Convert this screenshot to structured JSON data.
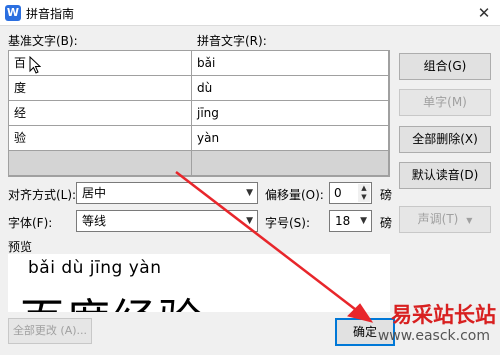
{
  "window": {
    "title": "拼音指南",
    "app_icon_glyph": "W",
    "close_glyph": "✕"
  },
  "columns": {
    "base_text": "基准文字(B):",
    "pinyin_text": "拼音文字(R):"
  },
  "rows": [
    {
      "base": "百",
      "pinyin": "bǎi"
    },
    {
      "base": "度",
      "pinyin": "dù"
    },
    {
      "base": "经",
      "pinyin": "jīng"
    },
    {
      "base": "验",
      "pinyin": "yàn"
    }
  ],
  "buttons": {
    "combine": "组合(G)",
    "single": "单字(M)",
    "delete_all": "全部删除(X)",
    "default_reading": "默认读音(D)",
    "tone": "声调(T)",
    "change_all": "全部更改 (A)...",
    "ok": "确定"
  },
  "align": {
    "label": "对齐方式(L):",
    "value": "居中"
  },
  "offset": {
    "label": "偏移量(O):",
    "value": "0",
    "unit": "磅"
  },
  "font": {
    "label": "字体(F):",
    "value": "等线"
  },
  "size": {
    "label": "字号(S):",
    "value": "18",
    "unit": "磅"
  },
  "preview": {
    "label": "预览",
    "pinyin": "bǎi  dù  jīng  yàn",
    "hanzi": "百度经验"
  },
  "watermark": {
    "text": "易采站长站",
    "url": "www.easck.com"
  },
  "colors": {
    "accent": "#2b6fe0",
    "arrow": "#e8262b",
    "watermark": "#d82020"
  }
}
